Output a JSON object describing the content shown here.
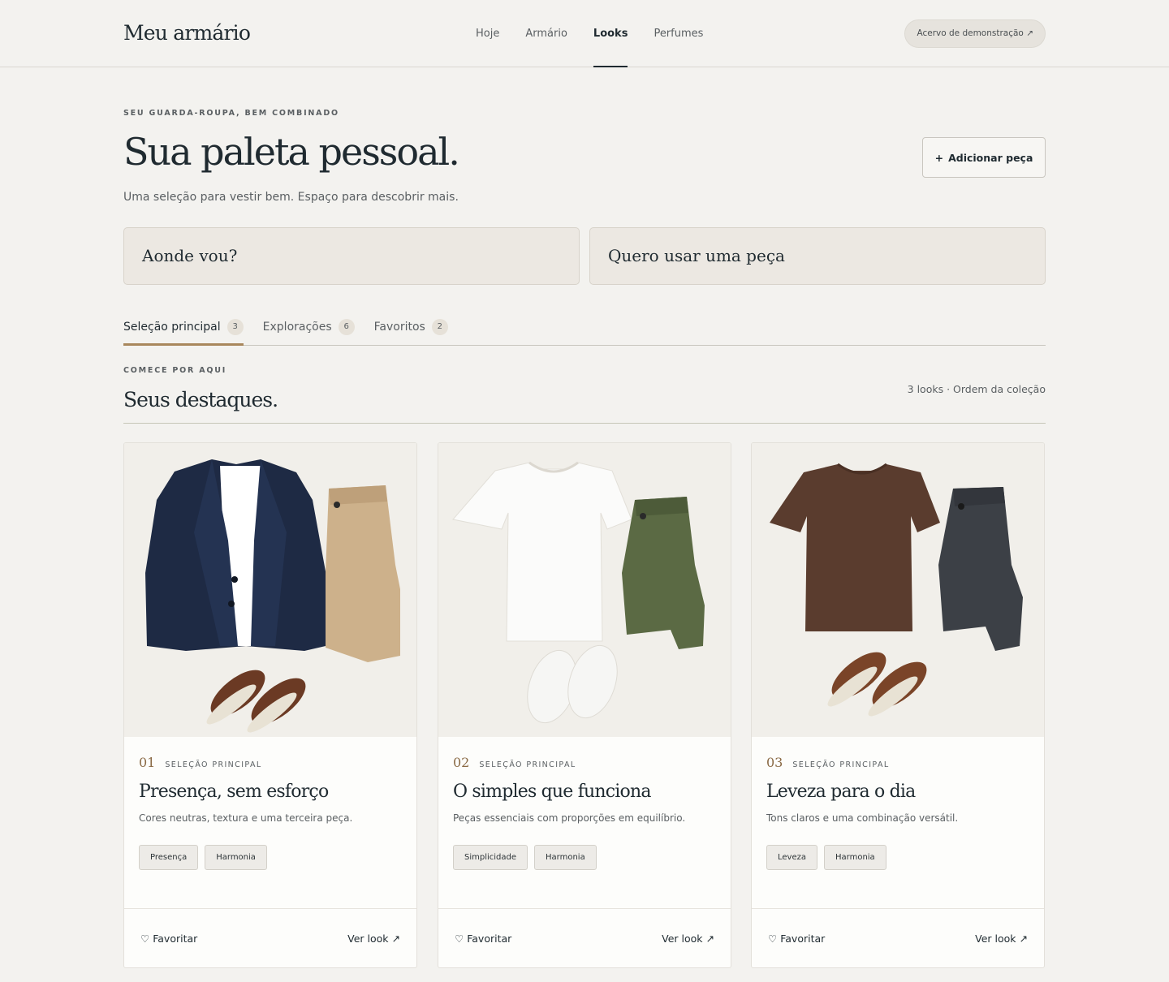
{
  "header": {
    "brand": "Meu armário",
    "nav": [
      "Hoje",
      "Armário",
      "Looks",
      "Perfumes"
    ],
    "active_nav": "Looks",
    "demo_label": "Acervo de demonstração ↗"
  },
  "hero": {
    "eyebrow": "SEU GUARDA-ROUPA, BEM COMBINADO",
    "title": "Sua paleta pessoal.",
    "subtitle": "Uma seleção para vestir bem. Espaço para descobrir mais.",
    "add_button": "Adicionar peça",
    "add_icon": "+"
  },
  "prompts": {
    "left": "Aonde vou?",
    "right": "Quero usar uma peça"
  },
  "tabs": [
    {
      "label": "Seleção principal",
      "count": "3"
    },
    {
      "label": "Explorações",
      "count": "6"
    },
    {
      "label": "Favoritos",
      "count": "2"
    }
  ],
  "section": {
    "eyebrow": "COMECE POR AQUI",
    "title": "Seus destaques.",
    "meta": "3 looks · Ordem da coleção"
  },
  "cards": [
    {
      "num": "01",
      "category": "SELEÇÃO PRINCIPAL",
      "title": "Presença, sem esforço",
      "desc": "Cores neutras, textura e uma terceira peça.",
      "tags": [
        "Presença",
        "Harmonia"
      ],
      "favorite": "Favoritar",
      "view": "Ver look ↗",
      "colors": {
        "top": "#1e2a44",
        "inner": "#ffffff",
        "pants": "#cdb18b",
        "shoes": "#6b3a24"
      }
    },
    {
      "num": "02",
      "category": "SELEÇÃO PRINCIPAL",
      "title": "O simples que funciona",
      "desc": "Peças essenciais com proporções em equilíbrio.",
      "tags": [
        "Simplicidade",
        "Harmonia"
      ],
      "favorite": "Favoritar",
      "view": "Ver look ↗",
      "colors": {
        "top": "#fbfbfa",
        "pants": "#5b6a44",
        "shoes": "#f6f6f4"
      }
    },
    {
      "num": "03",
      "category": "SELEÇÃO PRINCIPAL",
      "title": "Leveza para o dia",
      "desc": "Tons claros e uma combinação versátil.",
      "tags": [
        "Leveza",
        "Harmonia"
      ],
      "favorite": "Favoritar",
      "view": "Ver look ↗",
      "colors": {
        "top": "#5a3c2e",
        "pants": "#3c4046",
        "shoes": "#7a4428"
      }
    }
  ]
}
